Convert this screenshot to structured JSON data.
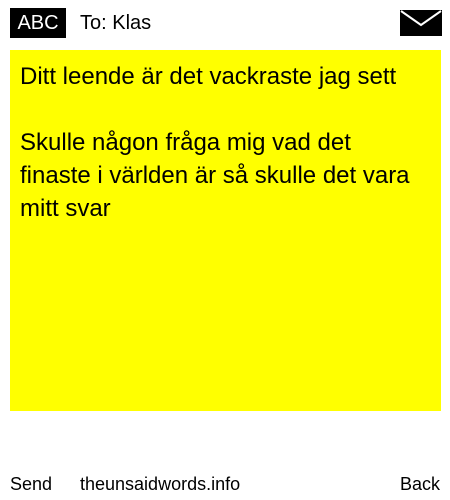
{
  "header": {
    "input_mode": "ABC",
    "recipient": "To: Klas",
    "envelope_icon": "envelope-icon"
  },
  "message": {
    "line_1": "Ditt leende är det vackraste jag sett",
    "line_2": "Skulle någon fråga mig vad det finaste i världen är så skulle det vara mitt svar"
  },
  "footer": {
    "send_label": "Send",
    "site_label": "theunsaidwords.info",
    "back_label": "Back"
  },
  "colors": {
    "message_background": "#ffff00",
    "badge_background": "#000000"
  }
}
